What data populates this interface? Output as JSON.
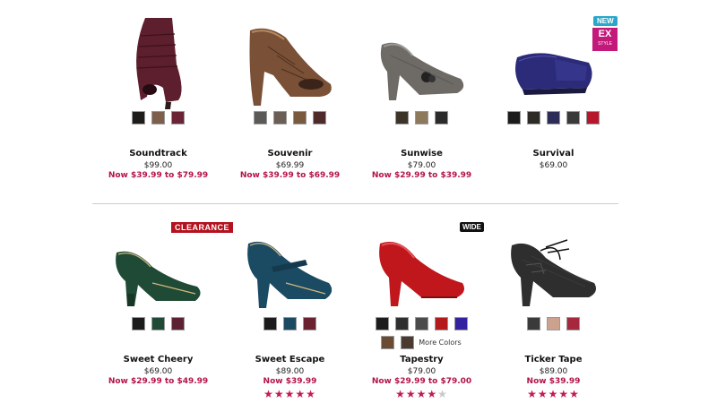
{
  "products_row1": [
    {
      "name": "Soundtrack",
      "price": "$99.00",
      "sale": "Now $39.99 to $79.99",
      "swatches": [
        "#1e1b1b",
        "#7d5f4b",
        "#6a2436"
      ]
    },
    {
      "name": "Souvenir",
      "price": "$69.99",
      "sale": "Now $39.99 to $69.99",
      "swatches": [
        "#5b5a57",
        "#6a5e55",
        "#7a5a3e",
        "#4e2a2b"
      ]
    },
    {
      "name": "Sunwise",
      "price": "$79.00",
      "sale": "Now $29.99 to $39.99",
      "swatches": [
        "#3d3429",
        "#8d7a5c",
        "#2b2b2b"
      ]
    },
    {
      "name": "Survival",
      "price": "$69.00",
      "sale": "",
      "swatches": [
        "#1c1c1c",
        "#2e2a26",
        "#2c2c56",
        "#3a3a3a",
        "#b7172a"
      ]
    }
  ],
  "products_row2": [
    {
      "name": "Sweet Cheery",
      "price": "$69.00",
      "sale": "Now $29.99 to $49.99",
      "swatches": [
        "#1b1b1b",
        "#1f4a35",
        "#5c2233"
      ],
      "rating": 0
    },
    {
      "name": "Sweet Escape",
      "price": "$89.00",
      "sale": "Now $39.99",
      "swatches": [
        "#1b1b1b",
        "#1b4a63",
        "#6a2231"
      ],
      "rating": 5
    },
    {
      "name": "Tapestry",
      "price": "$79.00",
      "sale": "Now $29.99 to $79.00",
      "swatches": [
        "#1c1c1c",
        "#2f2f2f",
        "#4b4b4b",
        "#b51a1a",
        "#3222a0",
        "#6a4c35",
        "#4b3a2f"
      ],
      "more_colors": "More Colors",
      "rating": 4
    },
    {
      "name": "Ticker Tape",
      "price": "$89.00",
      "sale": "Now $39.99",
      "swatches": [
        "#3a3a3a",
        "#caa28e",
        "#a5283c"
      ],
      "rating": 5
    }
  ],
  "badges": {
    "new": "NEW",
    "ex_big": "EX",
    "ex_small": "STYLE",
    "clearance": "CLEARANCE",
    "wide": "WIDE"
  },
  "colors": {
    "sale": "#b3124a",
    "star": "#c21a55",
    "badge_new": "#2aa7c9",
    "badge_ex": "#c2197a",
    "badge_clearance": "#b3121e"
  }
}
